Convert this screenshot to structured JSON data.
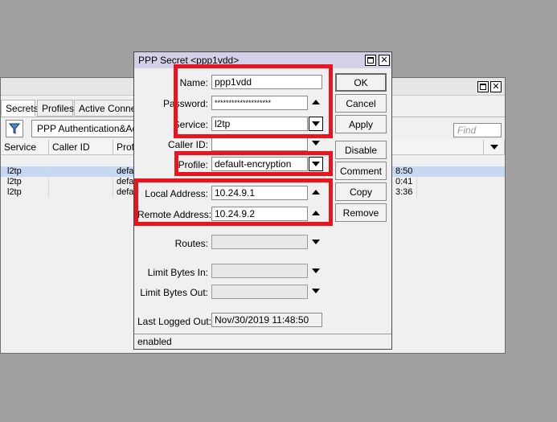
{
  "secrets_window": {
    "tabs": [
      "Secrets",
      "Profiles",
      "Active Connections"
    ],
    "auth_button": "PPP Authentication&Accounting",
    "find_placeholder": "Find",
    "columns": [
      "Service",
      "Caller ID",
      "Profile"
    ],
    "rows": [
      {
        "service": "l2tp",
        "profile": "defa",
        "last_logged": "8:50"
      },
      {
        "service": "l2tp",
        "profile": "defa",
        "last_logged": "0:41"
      },
      {
        "service": "l2tp",
        "profile": "defa",
        "last_logged": "3:36"
      }
    ]
  },
  "dialog": {
    "title": "PPP Secret <ppp1vdd>",
    "fields": {
      "name": {
        "label": "Name:",
        "value": "ppp1vdd"
      },
      "password": {
        "label": "Password:",
        "value": "********************"
      },
      "service": {
        "label": "Service:",
        "value": "l2tp"
      },
      "caller_id": {
        "label": "Caller ID:",
        "value": ""
      },
      "profile": {
        "label": "Profile:",
        "value": "default-encryption"
      },
      "local_address": {
        "label": "Local Address:",
        "value": "10.24.9.1"
      },
      "remote_address": {
        "label": "Remote Address:",
        "value": "10.24.9.2"
      },
      "routes": {
        "label": "Routes:",
        "value": ""
      },
      "limit_in": {
        "label": "Limit Bytes In:",
        "value": ""
      },
      "limit_out": {
        "label": "Limit Bytes Out:",
        "value": ""
      },
      "last_logged_out": {
        "label": "Last Logged Out:",
        "value": "Nov/30/2019 11:48:50"
      }
    },
    "buttons": {
      "ok": "OK",
      "cancel": "Cancel",
      "apply": "Apply",
      "disable": "Disable",
      "comment": "Comment",
      "copy": "Copy",
      "remove": "Remove"
    },
    "status": "enabled"
  },
  "colors": {
    "highlight": "#e8141e",
    "selected_row": "#c7d8f2"
  }
}
